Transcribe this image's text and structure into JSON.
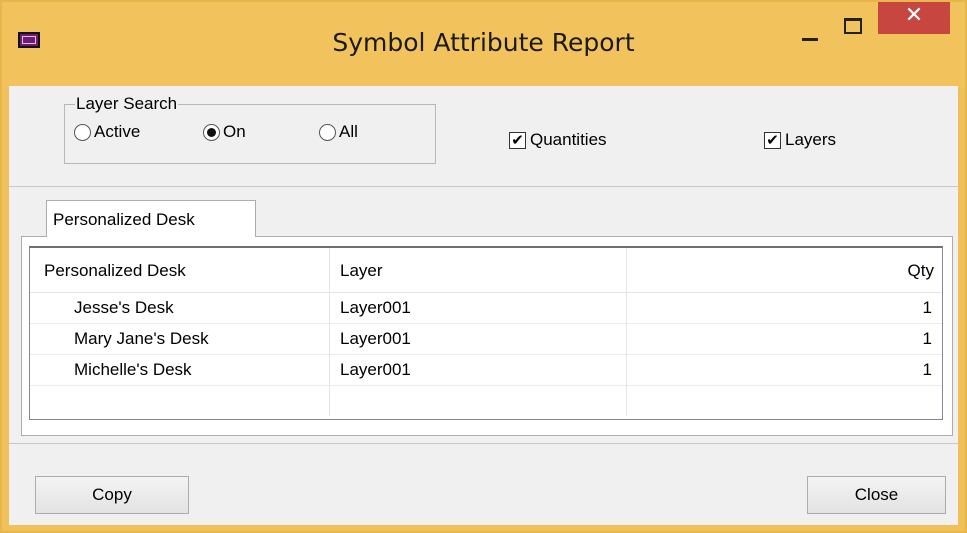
{
  "window": {
    "title": "Symbol Attribute Report",
    "close_glyph": "✕",
    "accent_color": "#f2c35d",
    "close_color": "#c7463f"
  },
  "layer_search": {
    "legend": "Layer Search",
    "options": [
      {
        "label": "Active",
        "selected": false
      },
      {
        "label": "On",
        "selected": true
      },
      {
        "label": "All",
        "selected": false
      }
    ]
  },
  "checkboxes": {
    "quantities": {
      "label": "Quantities",
      "checked": true
    },
    "layers": {
      "label": "Layers",
      "checked": true
    }
  },
  "tabs": [
    {
      "label": "Personalized Desk",
      "active": true
    }
  ],
  "table": {
    "headers": [
      "Personalized Desk",
      "Layer",
      "Qty"
    ],
    "rows": [
      [
        "Jesse's Desk",
        "Layer001",
        "1"
      ],
      [
        "Mary Jane's Desk",
        "Layer001",
        "1"
      ],
      [
        "Michelle's Desk",
        "Layer001",
        "1"
      ]
    ]
  },
  "buttons": {
    "copy": "Copy",
    "close": "Close"
  },
  "icons": {
    "app": "app-window-icon",
    "minimize": "minimize-icon",
    "maximize": "maximize-icon",
    "close": "close-icon",
    "check_glyph": "✔"
  }
}
